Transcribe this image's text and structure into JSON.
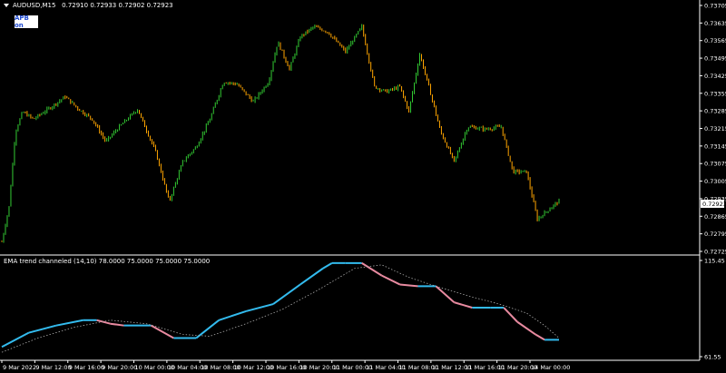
{
  "main_header": {
    "symbol": "AUDUSD,M15",
    "ohlc": "0.72910 0.72933 0.72902 0.72923"
  },
  "apb_badge": "APB on",
  "indicator_header": "EMA trend channeled (14,10) 78.0000 75.0000 75.0000 75.0000",
  "current_price_label": "0.72923",
  "price_axis": [
    "0.73705",
    "0.73635",
    "0.73565",
    "0.73495",
    "0.73425",
    "0.73355",
    "0.73285",
    "0.73215",
    "0.73145",
    "0.73075",
    "0.73005",
    "0.72935",
    "0.72865",
    "0.72795",
    "0.72725"
  ],
  "indicator_axis": [
    "115.45",
    "61.55"
  ],
  "time_axis": [
    "9 Mar 2022",
    "9 Mar 12:00",
    "9 Mar 16:00",
    "9 Mar 20:00",
    "10 Mar 00:00",
    "10 Mar 04:00",
    "10 Mar 08:00",
    "10 Mar 12:00",
    "10 Mar 16:00",
    "10 Mar 20:00",
    "11 Mar 00:00",
    "11 Mar 04:00",
    "11 Mar 08:00",
    "11 Mar 12:00",
    "11 Mar 16:00",
    "11 Mar 20:00",
    "14 Mar 00:00"
  ],
  "colors": {
    "bull": "#33cc33",
    "bear": "#ffa500",
    "ema_up": "#33bbee",
    "ema_down": "#e88aa0",
    "dotted": "#aaaaaa",
    "grid": "#ffffff",
    "price_box": "#ffffff"
  },
  "chart_data": {
    "type": "candlestick",
    "price_range": [
      0.72725,
      0.73705
    ],
    "close_path": [
      {
        "t": 0,
        "v": 0.7276
      },
      {
        "t": 8,
        "v": 0.729
      },
      {
        "t": 15,
        "v": 0.732
      },
      {
        "t": 23,
        "v": 0.7328
      },
      {
        "t": 35,
        "v": 0.7325
      },
      {
        "t": 55,
        "v": 0.733
      },
      {
        "t": 70,
        "v": 0.7334
      },
      {
        "t": 85,
        "v": 0.7329
      },
      {
        "t": 100,
        "v": 0.7325
      },
      {
        "t": 115,
        "v": 0.7316
      },
      {
        "t": 130,
        "v": 0.7322
      },
      {
        "t": 150,
        "v": 0.7329
      },
      {
        "t": 170,
        "v": 0.7312
      },
      {
        "t": 185,
        "v": 0.7292
      },
      {
        "t": 200,
        "v": 0.7308
      },
      {
        "t": 215,
        "v": 0.7314
      },
      {
        "t": 230,
        "v": 0.7325
      },
      {
        "t": 245,
        "v": 0.734
      },
      {
        "t": 260,
        "v": 0.7339
      },
      {
        "t": 278,
        "v": 0.7332
      },
      {
        "t": 295,
        "v": 0.734
      },
      {
        "t": 305,
        "v": 0.7356
      },
      {
        "t": 318,
        "v": 0.7345
      },
      {
        "t": 330,
        "v": 0.7358
      },
      {
        "t": 345,
        "v": 0.7362
      },
      {
        "t": 360,
        "v": 0.736
      },
      {
        "t": 380,
        "v": 0.7352
      },
      {
        "t": 398,
        "v": 0.7362
      },
      {
        "t": 412,
        "v": 0.7338
      },
      {
        "t": 425,
        "v": 0.7336
      },
      {
        "t": 440,
        "v": 0.7338
      },
      {
        "t": 450,
        "v": 0.7328
      },
      {
        "t": 462,
        "v": 0.7351
      },
      {
        "t": 472,
        "v": 0.7338
      },
      {
        "t": 485,
        "v": 0.732
      },
      {
        "t": 500,
        "v": 0.7308
      },
      {
        "t": 515,
        "v": 0.7322
      },
      {
        "t": 535,
        "v": 0.7321
      },
      {
        "t": 552,
        "v": 0.7322
      },
      {
        "t": 565,
        "v": 0.7304
      },
      {
        "t": 580,
        "v": 0.7304
      },
      {
        "t": 592,
        "v": 0.7285
      },
      {
        "t": 605,
        "v": 0.7289
      },
      {
        "t": 616,
        "v": 0.72923
      }
    ],
    "indicator": {
      "range": [
        61.55,
        115.45
      ],
      "ema_path": [
        {
          "t": 0,
          "v": 67
        },
        {
          "t": 30,
          "v": 75
        },
        {
          "t": 60,
          "v": 79
        },
        {
          "t": 90,
          "v": 82
        },
        {
          "t": 105,
          "v": 82
        },
        {
          "t": 120,
          "v": 80
        },
        {
          "t": 135,
          "v": 79
        },
        {
          "t": 165,
          "v": 79
        },
        {
          "t": 190,
          "v": 72
        },
        {
          "t": 215,
          "v": 72
        },
        {
          "t": 240,
          "v": 82
        },
        {
          "t": 270,
          "v": 87
        },
        {
          "t": 300,
          "v": 91
        },
        {
          "t": 330,
          "v": 102
        },
        {
          "t": 355,
          "v": 111
        },
        {
          "t": 365,
          "v": 114
        },
        {
          "t": 380,
          "v": 114
        },
        {
          "t": 398,
          "v": 114
        },
        {
          "t": 420,
          "v": 107
        },
        {
          "t": 440,
          "v": 102
        },
        {
          "t": 460,
          "v": 101
        },
        {
          "t": 480,
          "v": 101
        },
        {
          "t": 500,
          "v": 92
        },
        {
          "t": 520,
          "v": 89
        },
        {
          "t": 540,
          "v": 89
        },
        {
          "t": 555,
          "v": 89
        },
        {
          "t": 570,
          "v": 81
        },
        {
          "t": 590,
          "v": 74
        },
        {
          "t": 600,
          "v": 71
        },
        {
          "t": 616,
          "v": 71
        }
      ],
      "dotted_path": [
        {
          "t": 0,
          "v": 64
        },
        {
          "t": 40,
          "v": 72
        },
        {
          "t": 80,
          "v": 78
        },
        {
          "t": 120,
          "v": 82
        },
        {
          "t": 160,
          "v": 80
        },
        {
          "t": 200,
          "v": 74
        },
        {
          "t": 230,
          "v": 73
        },
        {
          "t": 270,
          "v": 80
        },
        {
          "t": 310,
          "v": 88
        },
        {
          "t": 350,
          "v": 99
        },
        {
          "t": 390,
          "v": 111
        },
        {
          "t": 420,
          "v": 113
        },
        {
          "t": 450,
          "v": 106
        },
        {
          "t": 480,
          "v": 101
        },
        {
          "t": 520,
          "v": 95
        },
        {
          "t": 550,
          "v": 91
        },
        {
          "t": 580,
          "v": 86
        },
        {
          "t": 600,
          "v": 79
        },
        {
          "t": 616,
          "v": 72
        }
      ]
    }
  }
}
